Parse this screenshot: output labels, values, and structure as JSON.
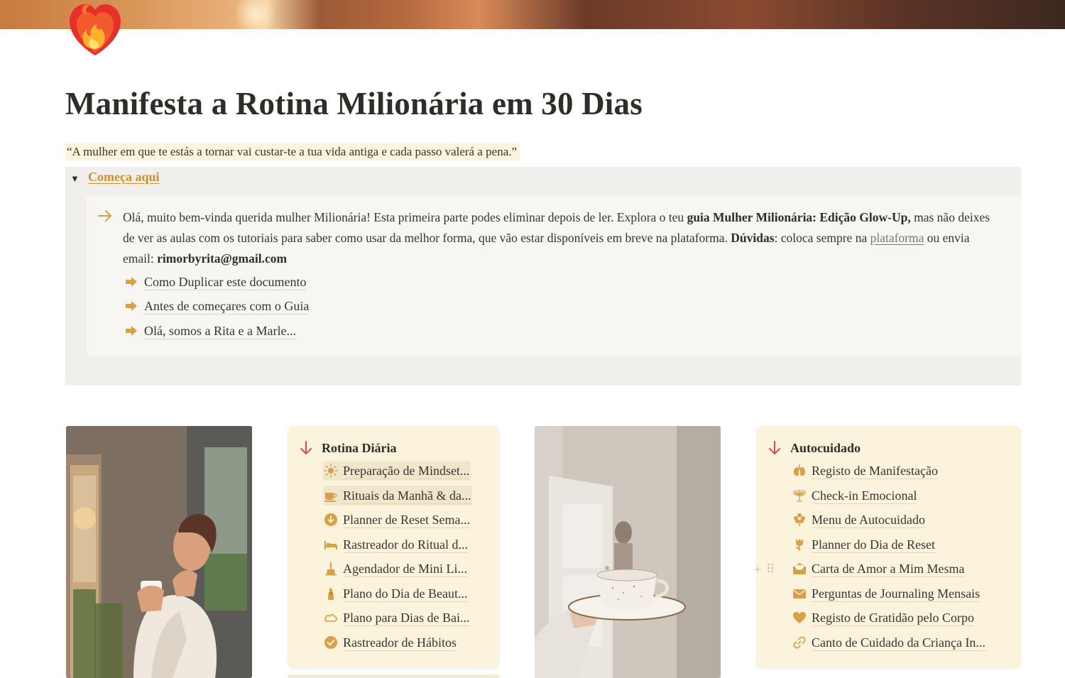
{
  "page": {
    "title": "Manifesta a Rotina Milionária em 30 Dias",
    "quote": "“A mulher em que te estás a tornar vai custar-te a tua vida antiga e cada passo valerá a pena.”"
  },
  "toggle": {
    "title": "Começa aqui",
    "expanded": true,
    "callout": {
      "text_1": "Olá, muito bem-vinda querida mulher Milionária! Esta primeira parte podes eliminar depois de ler. Explora o teu ",
      "bold_1": "guia Mulher Milionária: Edição Glow-Up,",
      "text_2": " mas não deixes de ver as aulas com os tutoriais para saber como usar da melhor forma, que vão estar disponíveis em breve na plataforma. ",
      "bold_2": "Dúvidas",
      "text_3": ": coloca sempre na ",
      "link": "plataforma",
      "text_4": " ou envia email: ",
      "email": "rimorbyrita@gmail.com"
    },
    "items": [
      {
        "label": "Como Duplicar este documento",
        "icon": "arrow-right-icon"
      },
      {
        "label": "Antes de começares com o Guia",
        "icon": "arrow-right-icon"
      },
      {
        "label": "Olá, somos a Rita e a Marle...",
        "icon": "arrow-right-icon"
      }
    ]
  },
  "rotina": {
    "heading": "Rotina Diária",
    "items": [
      {
        "label": "Preparação de Mindset...",
        "icon": "sun-icon"
      },
      {
        "label": "Rituais da Manhã & da...",
        "icon": "coffee-icon"
      },
      {
        "label": "Planner de Reset Sema...",
        "icon": "download-circle-icon"
      },
      {
        "label": "Rastreador do Ritual d...",
        "icon": "bed-icon"
      },
      {
        "label": "Agendador de Mini Li...",
        "icon": "broom-icon"
      },
      {
        "label": "Plano do Dia de Beaut...",
        "icon": "lipstick-icon"
      },
      {
        "label": "Plano para Dias de Bai...",
        "icon": "cloud-icon"
      },
      {
        "label": "Rastreador de Hábitos",
        "icon": "check-circle-icon"
      }
    ]
  },
  "autocuidado": {
    "heading": "Autocuidado",
    "items": [
      {
        "label": "Registo de Manifestação",
        "icon": "lungs-icon"
      },
      {
        "label": "Check-in Emocional",
        "icon": "menorah-icon"
      },
      {
        "label": "Menu de Autocuidado",
        "icon": "flower-icon"
      },
      {
        "label": "Planner do Dia de Reset",
        "icon": "tulip-icon"
      },
      {
        "label": "Carta de Amor a Mim Mesma",
        "icon": "open-mail-icon"
      },
      {
        "label": "Perguntas de Journaling Mensais",
        "icon": "envelope-icon"
      },
      {
        "label": "Registo de Gratidão pelo Corpo",
        "icon": "heart-icon"
      },
      {
        "label": "Canto de Cuidado da Criança In...",
        "icon": "link-icon"
      }
    ]
  },
  "colors": {
    "accent": "#cb912f",
    "icon_gold": "#d9a04a",
    "red_arrow": "#d44c47",
    "card_bg": "#fbf3db",
    "toggle_bg": "#f1efec",
    "callout_bg": "#f7f6f3"
  }
}
